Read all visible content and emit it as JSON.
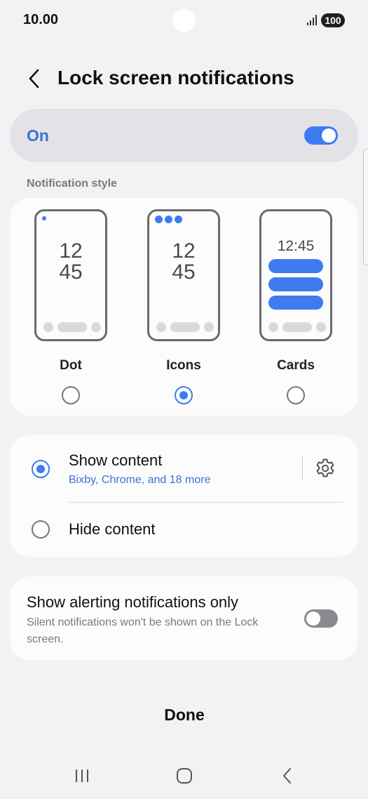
{
  "status_bar": {
    "time": "10.00",
    "battery": "100",
    "signal_icon": "signal-icon"
  },
  "header": {
    "title": "Lock screen notifications",
    "back_icon": "chevron-left-icon"
  },
  "master_switch": {
    "label": "On",
    "state": "on"
  },
  "notification_style": {
    "section_label": "Notification style",
    "options": [
      {
        "name": "Dot",
        "preview_clock": [
          "12",
          "45"
        ],
        "selected": false
      },
      {
        "name": "Icons",
        "preview_clock": [
          "12",
          "45"
        ],
        "selected": true
      },
      {
        "name": "Cards",
        "preview_clock": [
          "12:45"
        ],
        "selected": false
      }
    ]
  },
  "content_visibility": {
    "show": {
      "label": "Show content",
      "subtitle": "Bixby, Chrome, and 18 more",
      "selected": true,
      "settings_icon": "gear-icon"
    },
    "hide": {
      "label": "Hide content",
      "selected": false
    }
  },
  "alerting_only": {
    "title": "Show alerting notifications only",
    "description": "Silent notifications won't be shown on the Lock screen.",
    "state": "off"
  },
  "footer": {
    "done_label": "Done"
  },
  "nav_bar": {
    "recents_icon": "recents-icon",
    "home_icon": "home-icon",
    "back_icon": "back-icon"
  },
  "colors": {
    "accent": "#3e7bf0",
    "accent_text": "#3e6fd8",
    "background": "#f2f2f4",
    "card": "#fcfcfc"
  }
}
